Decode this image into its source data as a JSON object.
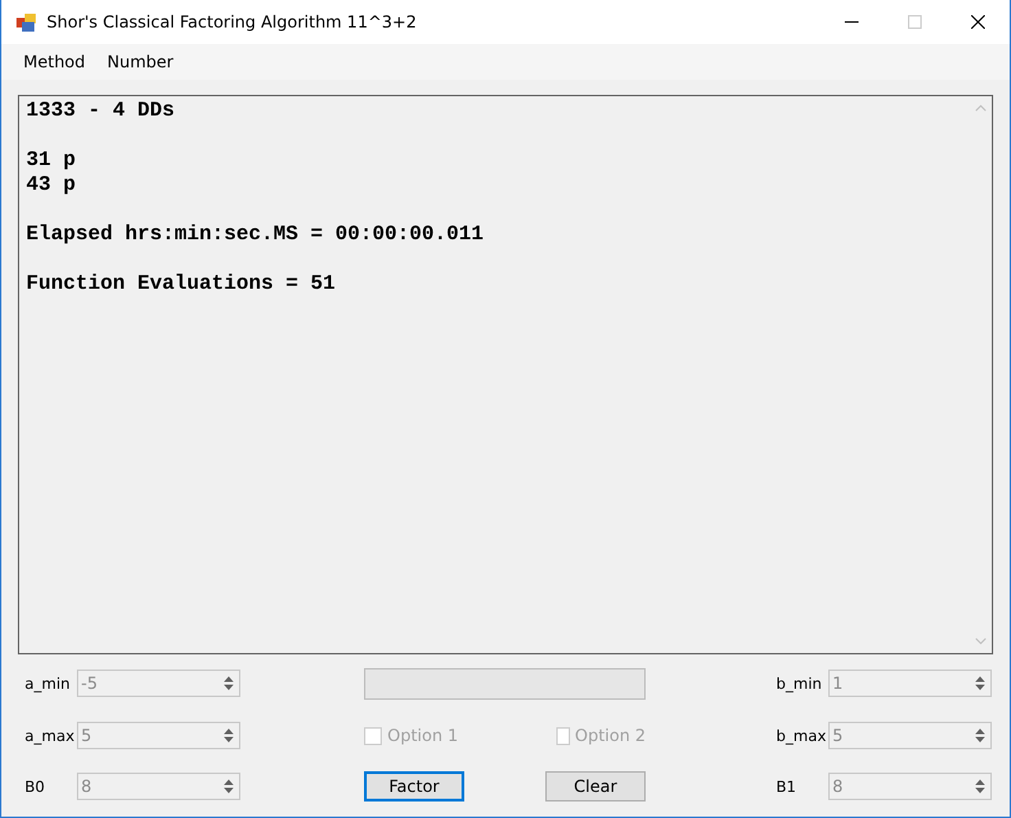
{
  "window": {
    "title": "Shor's Classical Factoring Algorithm 11^3+2",
    "controls": [
      {
        "kind": "minimize",
        "disabled": false
      },
      {
        "kind": "maximize",
        "disabled": true
      },
      {
        "kind": "close",
        "disabled": false
      }
    ]
  },
  "menu": [
    "Method",
    "Number"
  ],
  "output": {
    "blocks": [
      [
        "1333 - 4 DDs"
      ],
      [
        "31 p",
        "43 p"
      ],
      [
        "Elapsed hrs:min:sec.MS = 00:00:00.011"
      ],
      [
        "Function Evaluations = 51"
      ]
    ]
  },
  "spinners": [
    {
      "label": "a_min",
      "value": "-5",
      "disabled": true
    },
    {
      "label": "b_min",
      "value": "1",
      "disabled": true
    },
    {
      "label": "a_max",
      "value": "5",
      "disabled": true
    },
    {
      "label": "b_max",
      "value": "5",
      "disabled": true
    },
    {
      "label": "B0",
      "value": "8",
      "disabled": true
    },
    {
      "label": "B1",
      "value": "8",
      "disabled": true
    }
  ],
  "checkboxes": [
    {
      "label": "Option 1",
      "checked": false,
      "disabled": true
    },
    {
      "label": "Option 2",
      "checked": false,
      "disabled": true
    }
  ],
  "buttons": [
    {
      "label": "Factor",
      "focused": true
    },
    {
      "label": "Clear",
      "focused": false
    }
  ]
}
